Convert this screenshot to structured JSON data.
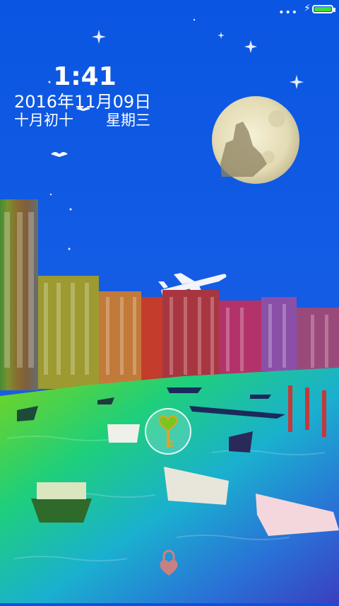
{
  "status_bar": {
    "signal_dots": "•••",
    "charging_icon": "bolt-icon",
    "battery_color": "#3fdc3f",
    "battery_level": 1.0
  },
  "lockscreen": {
    "time": "1:41",
    "date": "2016年11月09日",
    "lunar_date": "十月初十",
    "weekday": "星期三"
  },
  "unlock": {
    "icon": "heart-key-icon",
    "bottom_icon": "padlock-icon"
  },
  "colors": {
    "sky": "#0a52e0",
    "moon": "#efe9c6",
    "heart": "#78c61e",
    "key": "#d8a62a"
  }
}
